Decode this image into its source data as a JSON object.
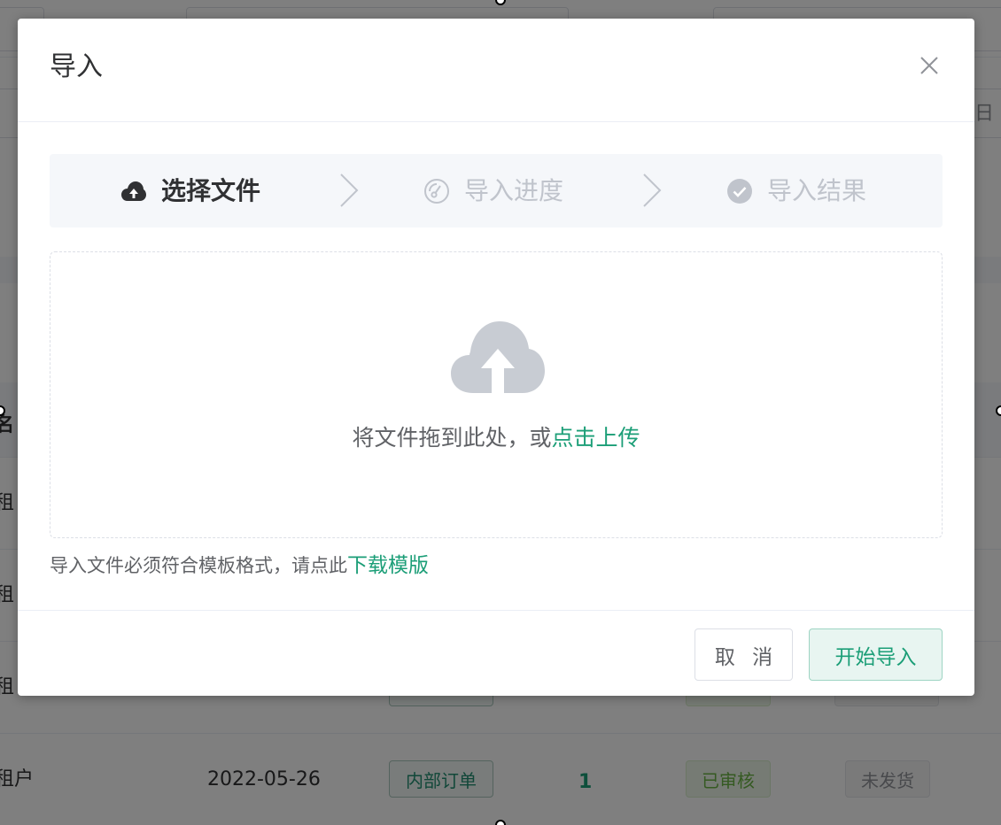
{
  "background": {
    "row": {
      "tenant": "租户",
      "date": "2022-05-26",
      "type_tag": "内部订单",
      "quantity": "1",
      "audit_tag": "已审核",
      "ship_tag": "未发货"
    },
    "row_first_char": "租",
    "header_first_char": "名",
    "right_edge_char": "日"
  },
  "dialog": {
    "title": "导入",
    "steps": [
      {
        "label": "选择文件",
        "icon": "cloud-upload-icon",
        "active": true
      },
      {
        "label": "导入进度",
        "icon": "gauge-icon",
        "active": false
      },
      {
        "label": "导入结果",
        "icon": "check-circle-icon",
        "active": false
      }
    ],
    "upload": {
      "icon": "cloud-upload-icon",
      "text": "将文件拖到此处，或",
      "link": "点击上传"
    },
    "tip": {
      "text": "导入文件必须符合模板格式，请点此",
      "link": "下载模版"
    },
    "buttons": {
      "cancel": "取 消",
      "start": "开始导入"
    }
  },
  "colors": {
    "accent": "#1b9e77",
    "mask": "rgba(0,0,0,0.5)"
  }
}
